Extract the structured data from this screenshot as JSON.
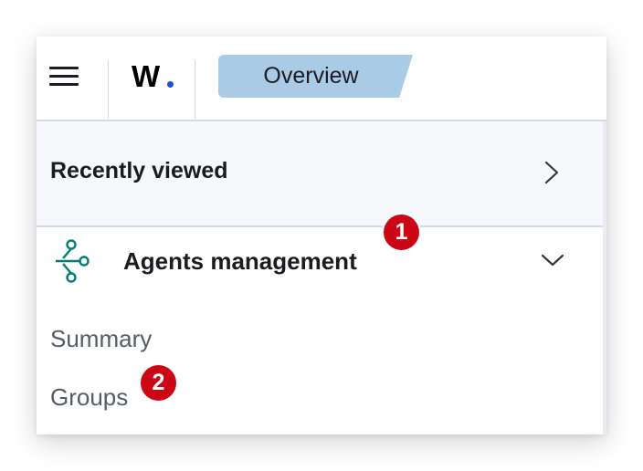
{
  "header": {
    "logo_text": "W",
    "breadcrumb_label": "Overview",
    "colors": {
      "breadcrumb_bg": "#a9cbe5",
      "logo_dot": "#1d4ed8"
    },
    "icons": {
      "menu": "hamburger-menu-icon"
    }
  },
  "nav": {
    "recently_viewed": {
      "label": "Recently viewed",
      "icon": "chevron-right-icon"
    },
    "agents_management": {
      "label": "Agents management",
      "icon": "agents-graph-icon",
      "expand_icon": "chevron-down-icon",
      "icon_color": "#017d73",
      "children": [
        {
          "label": "Summary"
        },
        {
          "label": "Groups"
        }
      ]
    }
  },
  "annotations": [
    {
      "label": "1",
      "color": "#cc0715"
    },
    {
      "label": "2",
      "color": "#cc0715"
    }
  ]
}
